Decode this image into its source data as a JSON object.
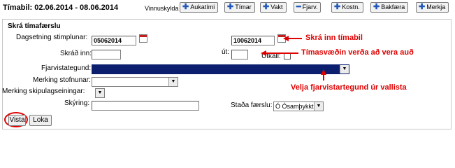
{
  "header": {
    "title": "Tímabil: 02.06.2014 - 08.06.2014",
    "subtitle": "Vinnuskylda",
    "buttons": [
      {
        "icon": "plus-icon",
        "label": "Aukatími"
      },
      {
        "icon": "plus-icon",
        "label": "Tímar"
      },
      {
        "icon": "plus-icon",
        "label": "Vakt"
      },
      {
        "icon": "minus-icon",
        "label": "Fjarv."
      },
      {
        "icon": "plus-icon",
        "label": "Kostn."
      },
      {
        "icon": "plus-icon",
        "label": "Bakfæra"
      },
      {
        "icon": "plus-icon",
        "label": "Merkja"
      }
    ]
  },
  "form": {
    "section_title": "Skrá tímafærslu",
    "date_label": "Dagsetning stimplunar:",
    "date_from": "05062014",
    "date_to": "10062014",
    "time_in_label": "Skráð inn:",
    "time_in_value": "",
    "time_out_label": "út:",
    "time_out_value": "",
    "overtime_label": "Útkall:",
    "absence_type_label": "Fjarvistategund:",
    "absence_type_value": "",
    "cost_center_label": "Merking stofnunar:",
    "cost_center_value": "",
    "unit_label": "Merking skipulagseiningar:",
    "unit_value": "",
    "note_label": "Skýring:",
    "note_value": "",
    "status_label": "Staða færslu:",
    "status_value": "Ó Ósamþykkt",
    "save_label": "Vista",
    "close_label": "Loka"
  },
  "annotations": {
    "register_time": "Skrá inn tímabil",
    "times_empty": "Tímasvæðin verða að vera auð",
    "choose_absence": "Velja fjarvistartegund úr vallista"
  },
  "colors": {
    "annotation": "#e00000",
    "selected_field": "#0b1f6e",
    "icon_blue": "#1f58b8"
  }
}
